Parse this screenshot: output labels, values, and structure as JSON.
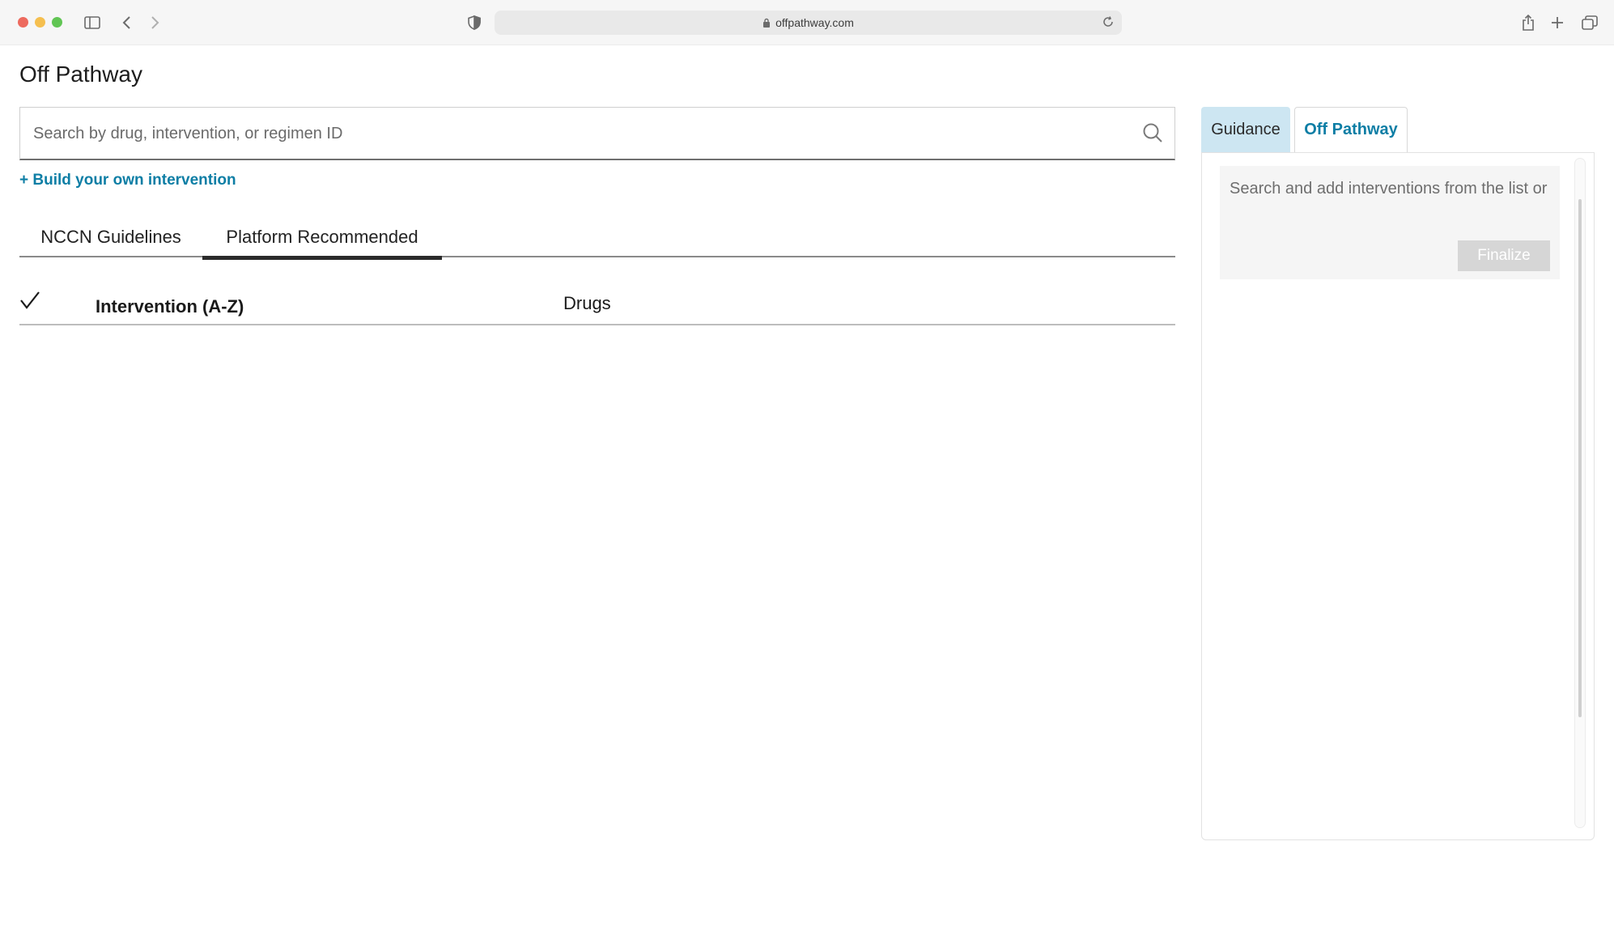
{
  "browser": {
    "url": "offpathway.com"
  },
  "page": {
    "title": "Off Pathway"
  },
  "search": {
    "placeholder": "Search by drug, intervention, or regimen ID",
    "value": ""
  },
  "build_link": "+ Build your own intervention",
  "tabs": [
    {
      "label": "NCCN Guidelines",
      "active": false
    },
    {
      "label": "Platform Recommended",
      "active": true
    }
  ],
  "table": {
    "columns": [
      "Intervention (A-Z)",
      "Drugs"
    ]
  },
  "panel": {
    "tabs": [
      {
        "label": "Guidance",
        "active": false
      },
      {
        "label": "Off Pathway",
        "active": true
      }
    ],
    "hint": "Search and add interventions from the list or",
    "finalize_label": "Finalize"
  },
  "colors": {
    "accent": "#0d7ea5",
    "guidance_tab_bg": "#cde6f2",
    "disabled_button": "#d6d6d6"
  }
}
